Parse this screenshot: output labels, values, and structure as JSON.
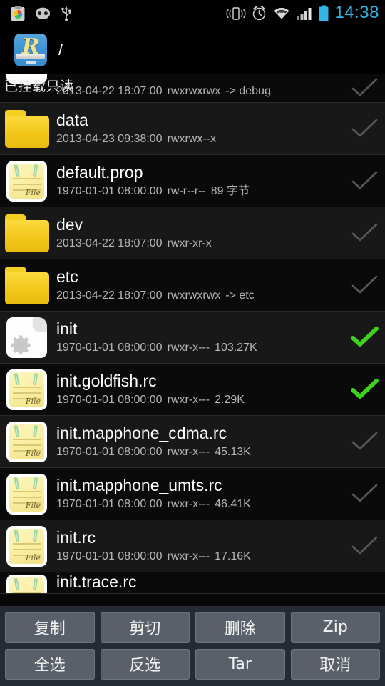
{
  "status_bar": {
    "icons_left": [
      "app-notification-icon",
      "cyanogenmod-icon",
      "usb-icon"
    ],
    "icons_right": [
      "vibrate-icon",
      "alarm-icon",
      "wifi-icon",
      "signal-icon",
      "battery-icon"
    ],
    "time": "14:38",
    "clock_color": "#33b5e5"
  },
  "title_bar": {
    "app_icon": "root-explorer-icon",
    "app_icon_letter": "R",
    "path": "/"
  },
  "mount_status": {
    "text": "已挂载只读"
  },
  "files": [
    {
      "name": "",
      "date": "2013-04-22 18:07:00",
      "perms": "rwxrwxrwx",
      "size": "-> debug",
      "icon": "gear-file-icon",
      "selected": false,
      "partial": "top"
    },
    {
      "name": "data",
      "date": "2013-04-23 09:38:00",
      "perms": "rwxrwx--x",
      "size": "",
      "icon": "folder-icon",
      "selected": false
    },
    {
      "name": "default.prop",
      "date": "1970-01-01 08:00:00",
      "perms": "rw-r--r--",
      "size": "89 字节",
      "icon": "note-file-icon",
      "selected": false
    },
    {
      "name": "dev",
      "date": "2013-04-22 18:07:00",
      "perms": "rwxr-xr-x",
      "size": "",
      "icon": "folder-icon",
      "selected": false
    },
    {
      "name": "etc",
      "date": "2013-04-22 18:07:00",
      "perms": "rwxrwxrwx",
      "size": "-> etc",
      "icon": "folder-icon",
      "selected": false
    },
    {
      "name": "init",
      "date": "1970-01-01 08:00:00",
      "perms": "rwxr-x---",
      "size": "103.27K",
      "icon": "executable-file-icon",
      "selected": true
    },
    {
      "name": "init.goldfish.rc",
      "date": "1970-01-01 08:00:00",
      "perms": "rwxr-x---",
      "size": "2.29K",
      "icon": "note-file-icon",
      "selected": true
    },
    {
      "name": "init.mapphone_cdma.rc",
      "date": "1970-01-01 08:00:00",
      "perms": "rwxr-x---",
      "size": "45.13K",
      "icon": "note-file-icon",
      "selected": false
    },
    {
      "name": "init.mapphone_umts.rc",
      "date": "1970-01-01 08:00:00",
      "perms": "rwxr-x---",
      "size": "46.41K",
      "icon": "note-file-icon",
      "selected": false
    },
    {
      "name": "init.rc",
      "date": "1970-01-01 08:00:00",
      "perms": "rwxr-x---",
      "size": "17.16K",
      "icon": "note-file-icon",
      "selected": false
    },
    {
      "name": "init.trace.rc",
      "date": "",
      "perms": "",
      "size": "",
      "icon": "note-file-icon",
      "selected": false,
      "partial": "bottom"
    }
  ],
  "action_bar": {
    "row1": [
      {
        "label": "复制",
        "name": "copy-button"
      },
      {
        "label": "剪切",
        "name": "cut-button"
      },
      {
        "label": "删除",
        "name": "delete-button"
      },
      {
        "label": "Zip",
        "name": "zip-button"
      }
    ],
    "row2": [
      {
        "label": "全选",
        "name": "select-all-button"
      },
      {
        "label": "反选",
        "name": "invert-selection-button"
      },
      {
        "label": "Tar",
        "name": "tar-button"
      },
      {
        "label": "取消",
        "name": "cancel-button"
      }
    ]
  },
  "colors": {
    "accent": "#33b5e5",
    "rule": "#6fb4dd",
    "selected_check": "#3fd020",
    "unselected_check": "#5a5a5a",
    "folder": "#f2c71a",
    "button_face": "#5a6069"
  }
}
